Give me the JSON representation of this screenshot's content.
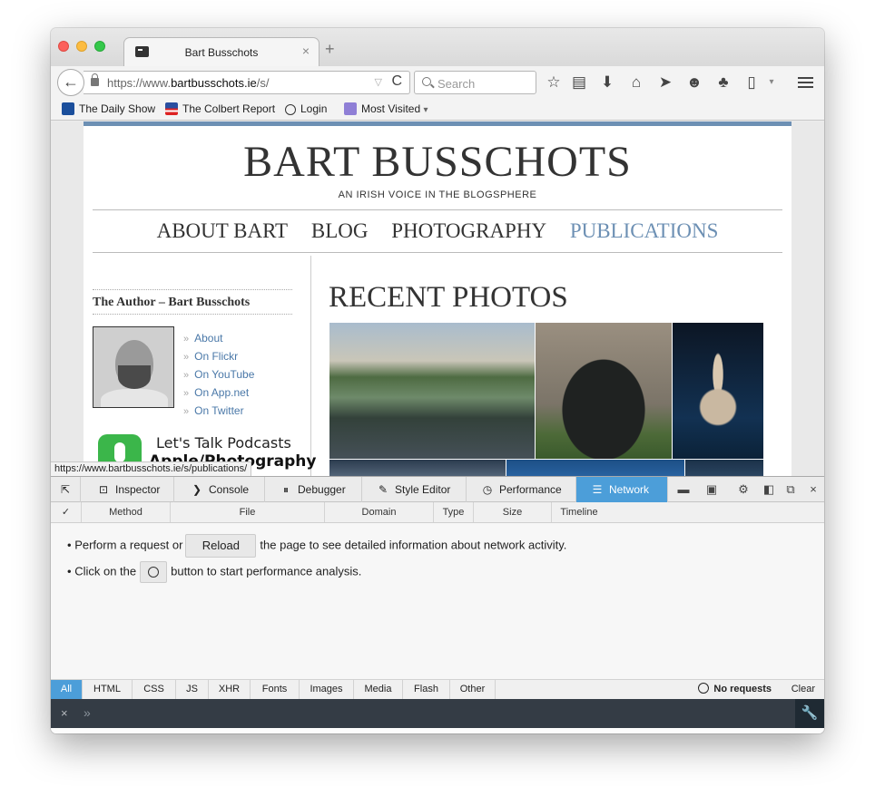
{
  "browser": {
    "tab": {
      "title": "Bart Busschots",
      "close": "×"
    },
    "newtab": "+",
    "back": "←",
    "url": {
      "prefix": "https://www.",
      "host": "bartbusschots.ie",
      "path": "/s/"
    },
    "reload": "C",
    "search_placeholder": "Search",
    "bookmarks": [
      "The Daily Show",
      "The Colbert Report",
      "Login",
      "Most Visited"
    ],
    "bookmark_dropdown": "▾",
    "status_url": "https://www.bartbusschots.ie/s/publications/"
  },
  "site": {
    "title": "BART BUSSCHOTS",
    "tagline": "AN IRISH VOICE IN THE BLOGSPHERE",
    "nav": [
      "ABOUT BART",
      "BLOG",
      "PHOTOGRAPHY",
      "PUBLICATIONS"
    ],
    "active_nav": "PUBLICATIONS",
    "sidebar_heading": "The Author – Bart Busschots",
    "author_links": [
      "About",
      "On Flickr",
      "On YouTube",
      "On App.net",
      "On Twitter"
    ],
    "link_chevron": "»",
    "podcast_line1": "Let's Talk Podcasts",
    "podcast_line2": "Apple/Photography",
    "recent_title": "RECENT PHOTOS"
  },
  "devtools": {
    "tabs": [
      "Inspector",
      "Console",
      "Debugger",
      "Style Editor",
      "Performance",
      "Network"
    ],
    "selected_tab": "Network",
    "columns": [
      "✓",
      "Method",
      "File",
      "Domain",
      "Type",
      "Size",
      "Timeline"
    ],
    "hint1_before": "Perform a request or",
    "reload_button": "Reload",
    "hint1_after": "the page to see detailed information about network activity.",
    "hint2_before": "Click on the",
    "hint2_after": "button to start performance analysis.",
    "bullet": "•",
    "filters": [
      "All",
      "HTML",
      "CSS",
      "JS",
      "XHR",
      "Fonts",
      "Images",
      "Media",
      "Flash",
      "Other"
    ],
    "selected_filter": "All",
    "status": "No requests",
    "clear": "Clear",
    "close": "×",
    "console_close": "×",
    "console_prompt": "»",
    "console_tool": "🔧"
  },
  "colors": {
    "accent": "#4c9ed9",
    "site_accent": "#6d90b4",
    "link": "#4a78a8"
  }
}
